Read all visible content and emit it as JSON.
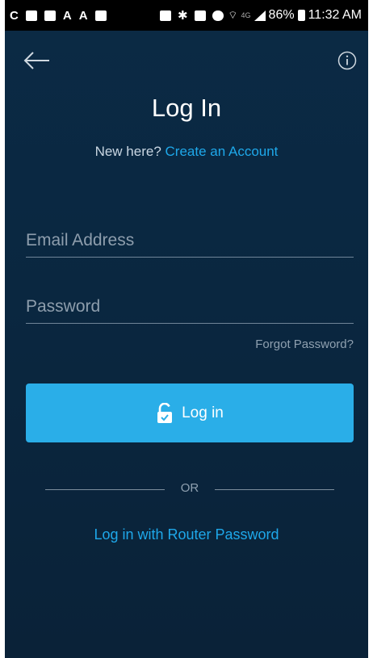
{
  "status_bar": {
    "left_glyphs": [
      "C",
      "A",
      "A"
    ],
    "battery_percent": "86%",
    "time": "11:32 AM",
    "network": "4G"
  },
  "header": {
    "back_icon": "arrow-left-icon",
    "info_icon": "info-icon",
    "title": "Log In"
  },
  "signup": {
    "prompt": "New here?",
    "link": "Create an Account"
  },
  "form": {
    "email_placeholder": "Email Address",
    "email_value": "",
    "password_placeholder": "Password",
    "password_value": "",
    "forgot_label": "Forgot Password?",
    "login_label": "Log in",
    "login_icon": "unlock-icon"
  },
  "alt": {
    "separator": "OR",
    "router_link": "Log in with Router Password"
  },
  "colors": {
    "background": "#0a2740",
    "accent": "#2aaee8",
    "link": "#1ea8ea"
  }
}
